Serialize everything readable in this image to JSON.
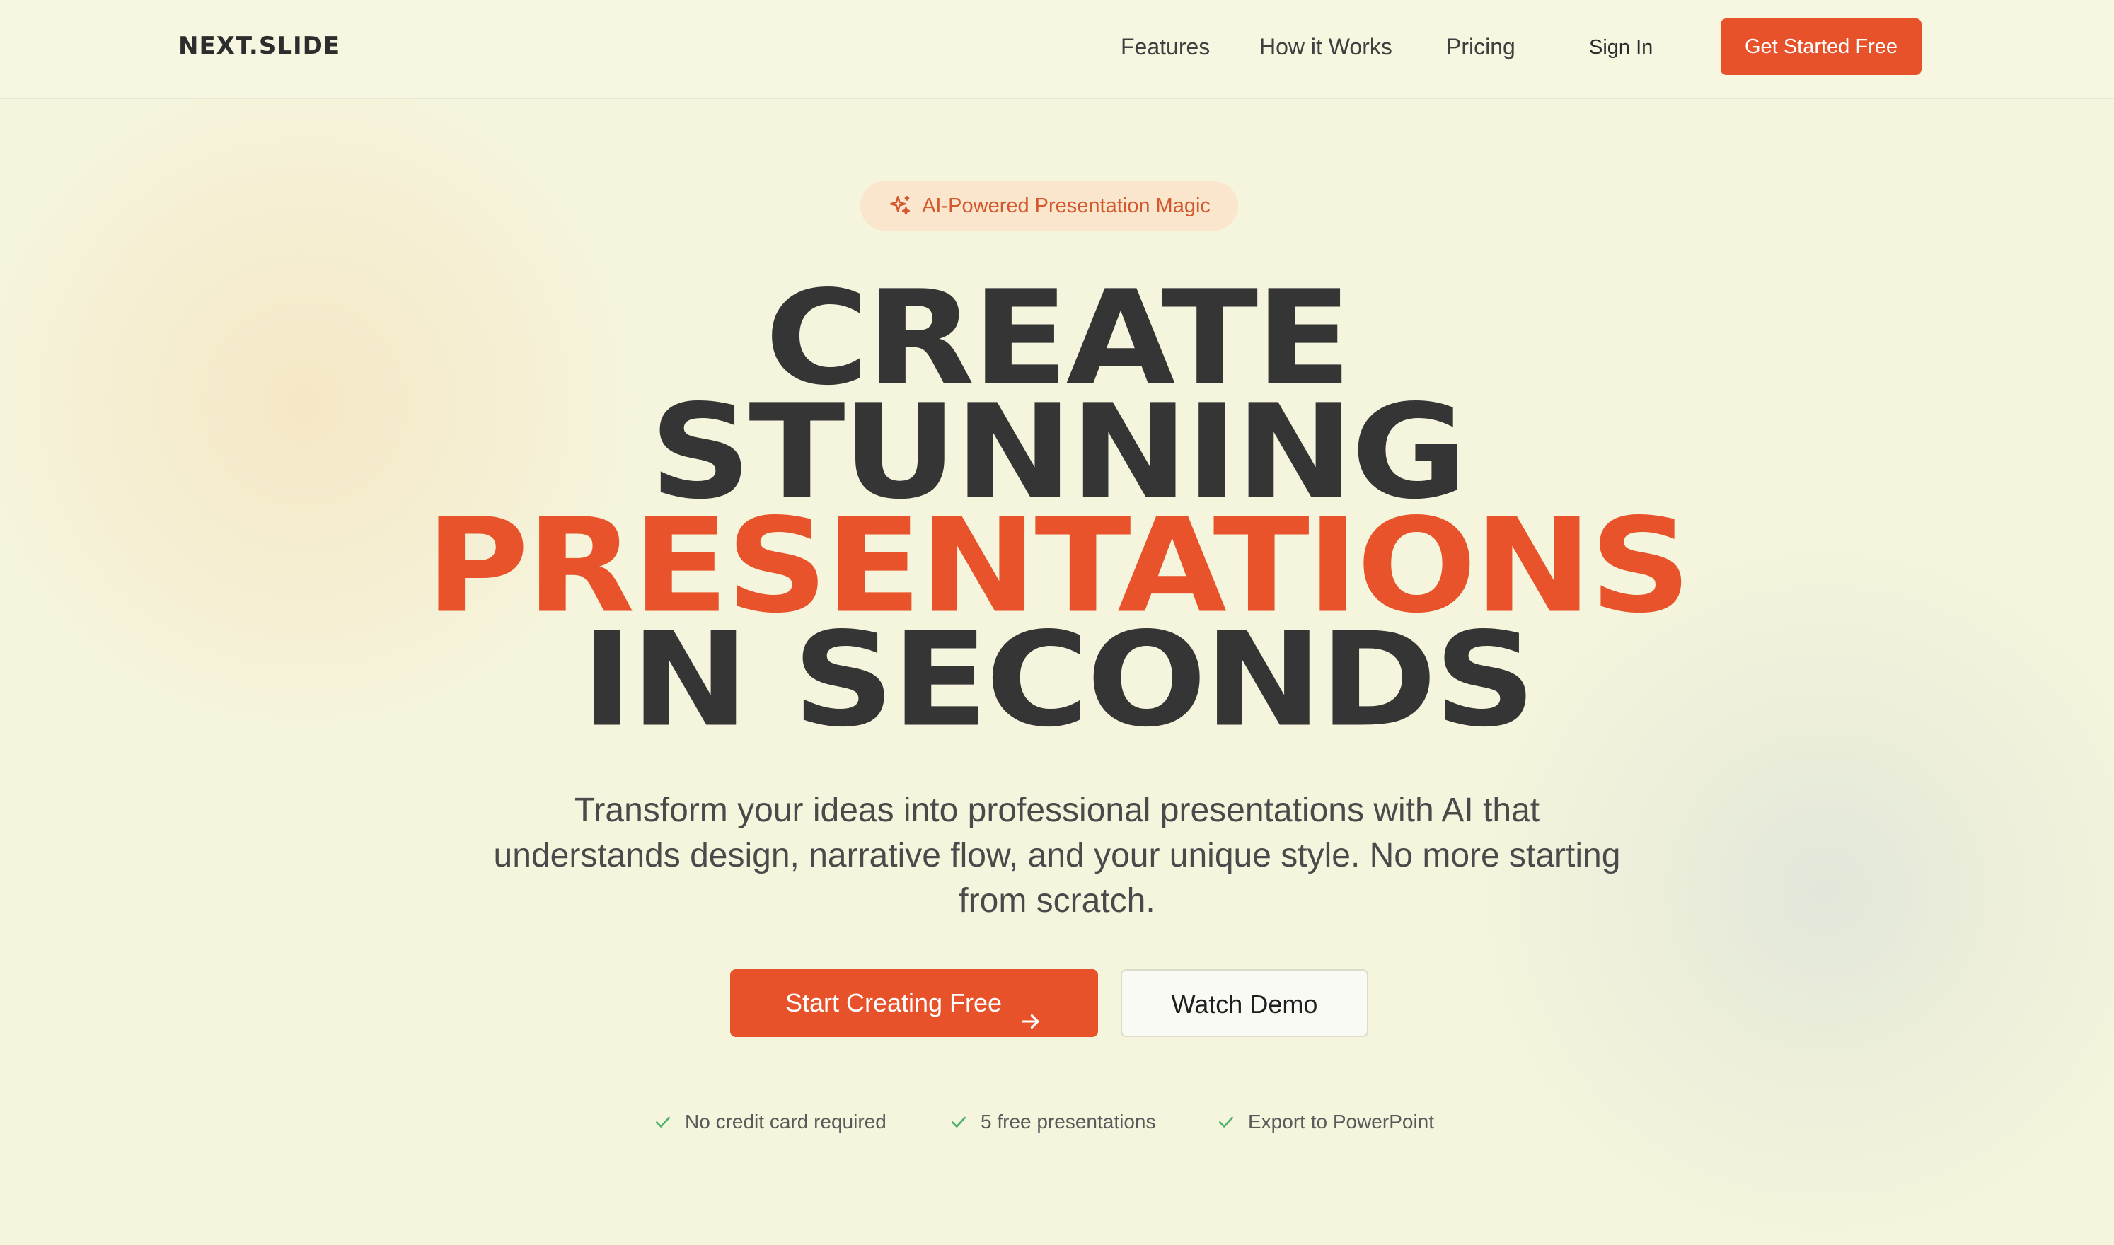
{
  "header": {
    "logo": "NEXT.SLIDE",
    "nav": [
      "Features",
      "How it Works",
      "Pricing"
    ],
    "sign_in": "Sign In",
    "cta": "Get Started Free"
  },
  "hero": {
    "badge": {
      "icon": "sparkles-icon",
      "text": "AI-Powered Presentation Magic"
    },
    "headline": {
      "line1": "CREATE",
      "line2": "STUNNING",
      "line3": "PRESENTATIONS",
      "line4": "IN SECONDS"
    },
    "subtitle": "Transform your ideas into professional presentations with AI that understands design, narrative flow, and your unique style. No more starting from scratch.",
    "primary_cta": {
      "label": "Start Creating Free",
      "icon": "arrow-right-icon"
    },
    "secondary_cta": {
      "label": "Watch Demo"
    },
    "perks": [
      {
        "icon": "check-icon",
        "text": "No credit card required"
      },
      {
        "icon": "check-icon",
        "text": "5 free presentations"
      },
      {
        "icon": "check-icon",
        "text": "Export to PowerPoint"
      }
    ]
  },
  "colors": {
    "accent": "#e8522a",
    "background": "#f5f4dc",
    "heading": "#353535",
    "badge_bg": "#f9e6cd",
    "check": "#4caf6a"
  }
}
